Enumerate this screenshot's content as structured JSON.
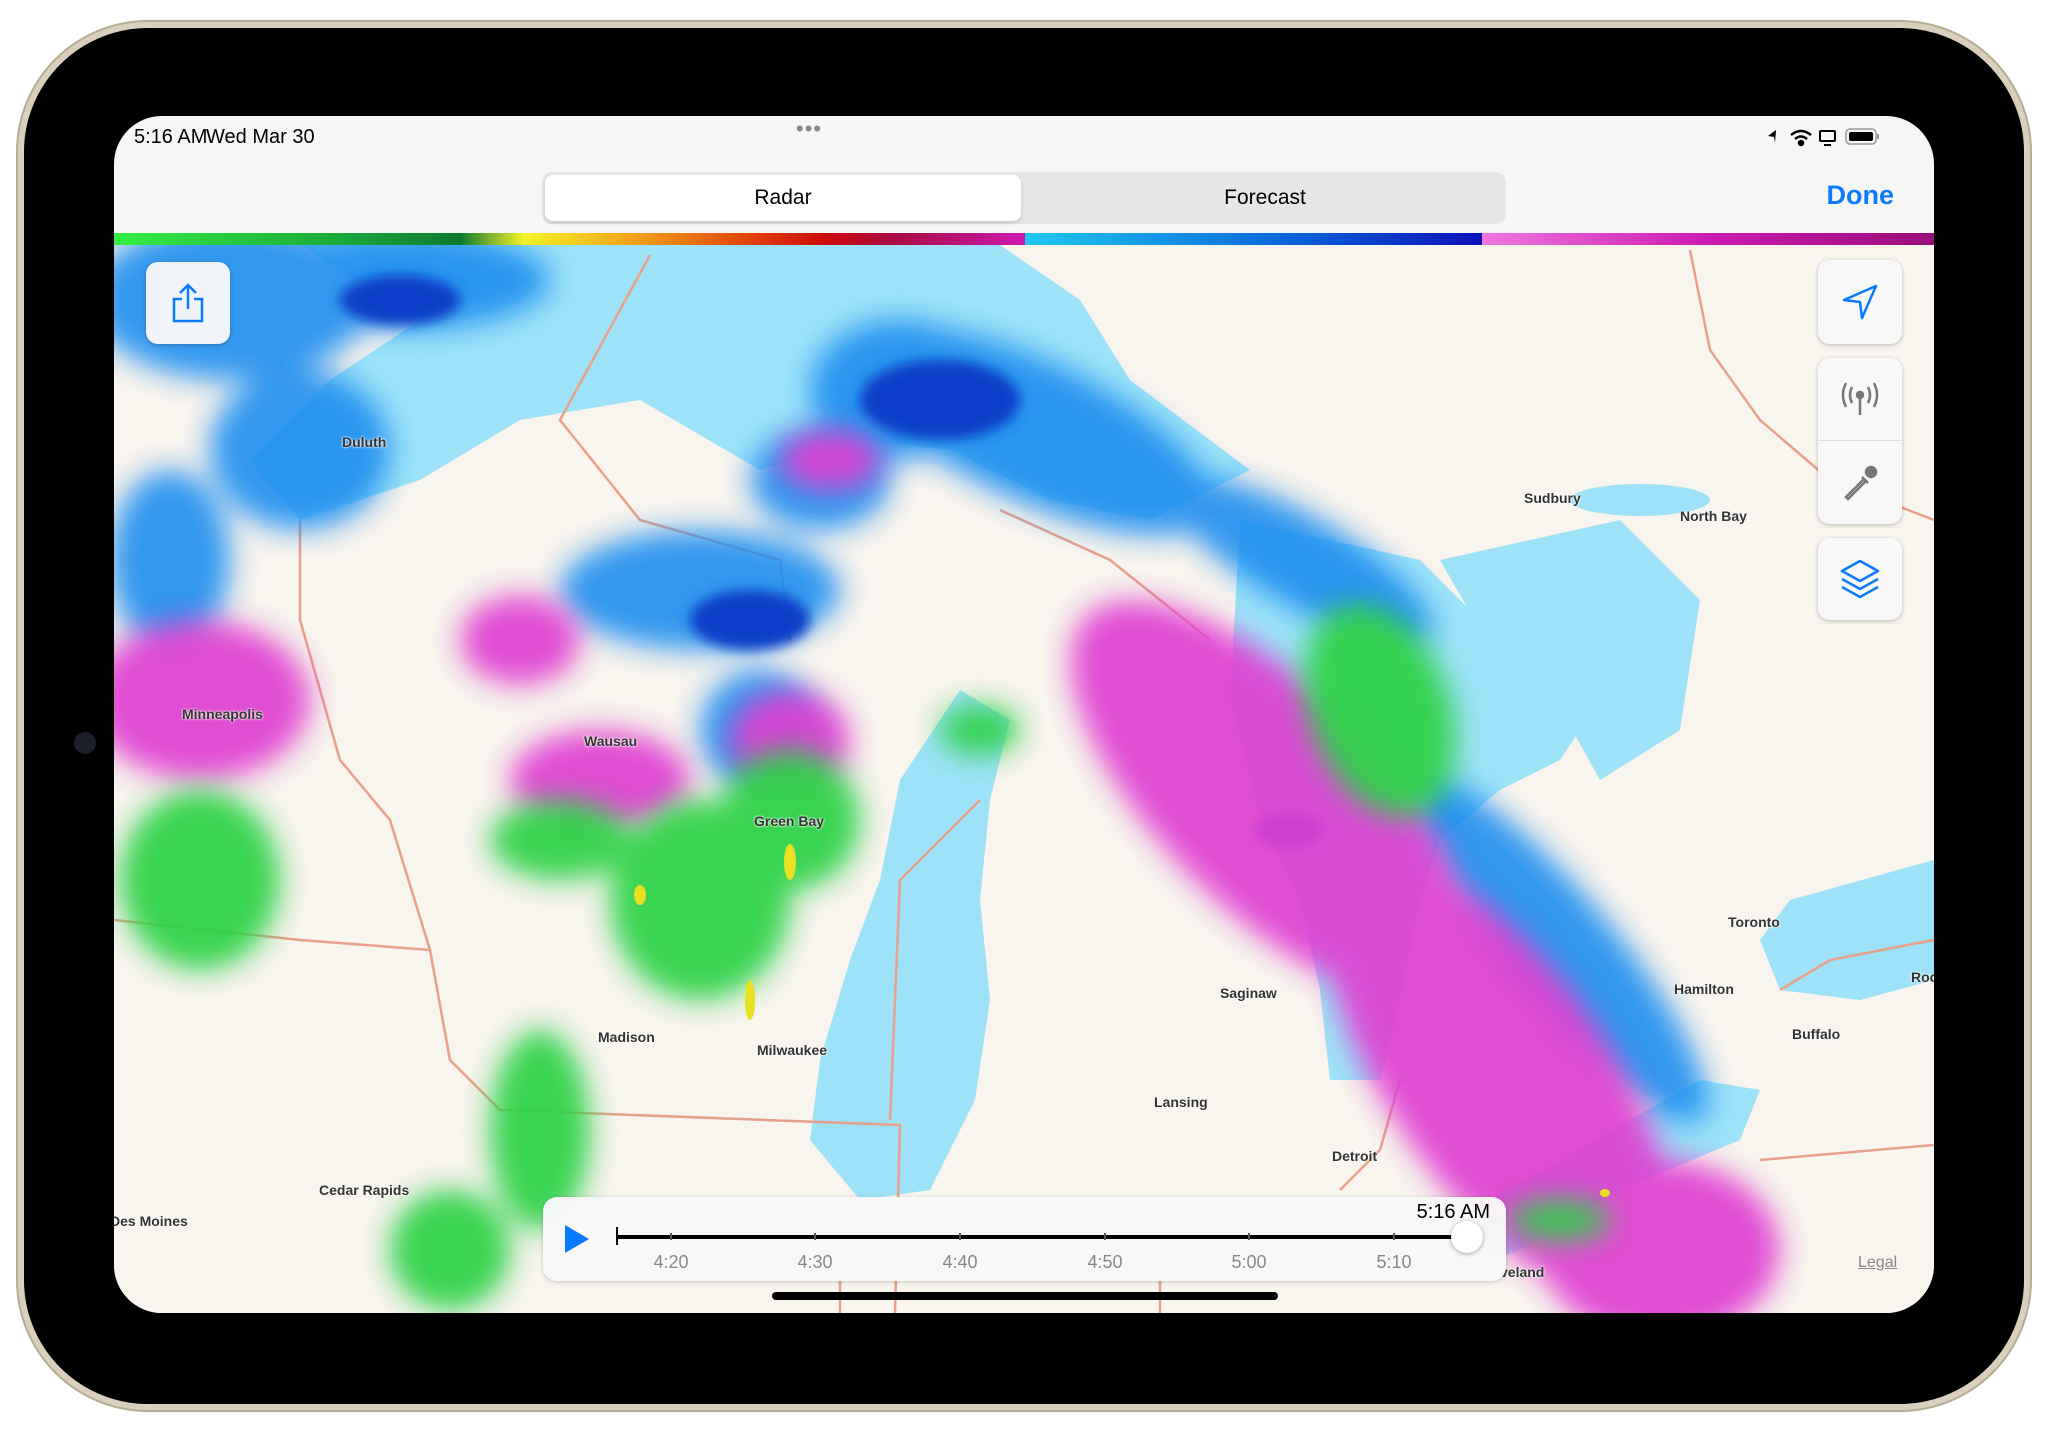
{
  "status_bar": {
    "time": "5:16 AM",
    "date": "Wed Mar 30",
    "multitask": "•••",
    "icons": [
      "location-arrow-icon",
      "wifi-icon",
      "screen-mirroring-icon",
      "battery-icon"
    ]
  },
  "segmented": {
    "options": [
      "Radar",
      "Forecast"
    ],
    "selected": "Radar"
  },
  "done_label": "Done",
  "legend_colors": [
    "#33ee44",
    "#0f8a2f",
    "#f5f22a",
    "#f0a21a",
    "#cc0a0a",
    "#cc1ab0",
    "#1ec8f0",
    "#0a10b8",
    "#ee77dd",
    "#9a0d7a"
  ],
  "map": {
    "cities": [
      "Duluth",
      "Minneapolis",
      "Wausau",
      "Green Bay",
      "Madison",
      "Milwaukee",
      "Cedar Rapids",
      "Des Moines",
      "Sudbury",
      "North Bay",
      "Saginaw",
      "Lansing",
      "Detroit",
      "Toronto",
      "Hamilton",
      "Buffalo",
      "Roc",
      "veland"
    ],
    "legal": "Legal"
  },
  "controls": {
    "share": "share-icon",
    "locate": "location-arrow-icon",
    "radar_station": "antenna-icon",
    "sample": "eyedropper-icon",
    "layers": "layers-icon"
  },
  "timeline": {
    "current_time": "5:16 AM",
    "ticks": [
      "4:20",
      "4:30",
      "4:40",
      "4:50",
      "5:00",
      "5:10"
    ],
    "progress": 1.0,
    "playing": false
  }
}
